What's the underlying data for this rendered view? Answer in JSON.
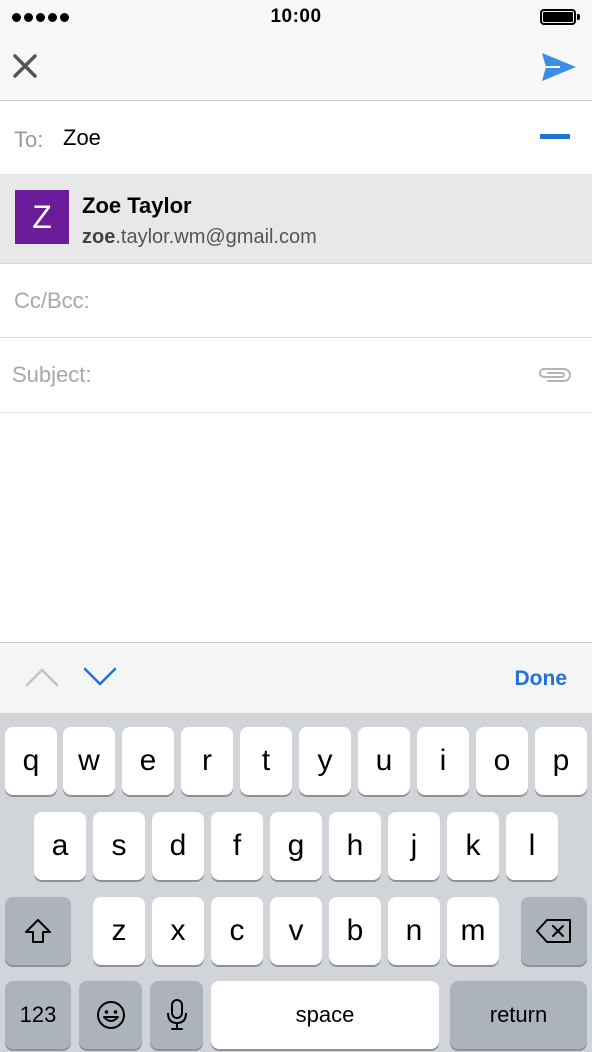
{
  "status_bar": {
    "time": "10:00"
  },
  "nav": {
    "close_icon": "close-x-icon",
    "send_icon": "send-paper-plane-icon",
    "accent_color": "#1e73d8"
  },
  "compose": {
    "to_label": "To:",
    "to_value": "Zoe",
    "cc_placeholder": "Cc/Bcc:",
    "subject_placeholder": "Subject:"
  },
  "suggestion": {
    "initial": "Z",
    "name": "Zoe Taylor",
    "email_match": "zoe",
    "email_rest": ".taylor.wm@gmail.com",
    "avatar_color": "#6a1b9a"
  },
  "accessory": {
    "done_label": "Done"
  },
  "keyboard": {
    "row1": [
      "q",
      "w",
      "e",
      "r",
      "t",
      "y",
      "u",
      "i",
      "o",
      "p"
    ],
    "row2": [
      "a",
      "s",
      "d",
      "f",
      "g",
      "h",
      "j",
      "k",
      "l"
    ],
    "row3": [
      "z",
      "x",
      "c",
      "v",
      "b",
      "n",
      "m"
    ],
    "numbers_label": "123",
    "space_label": "space",
    "return_label": "return"
  }
}
